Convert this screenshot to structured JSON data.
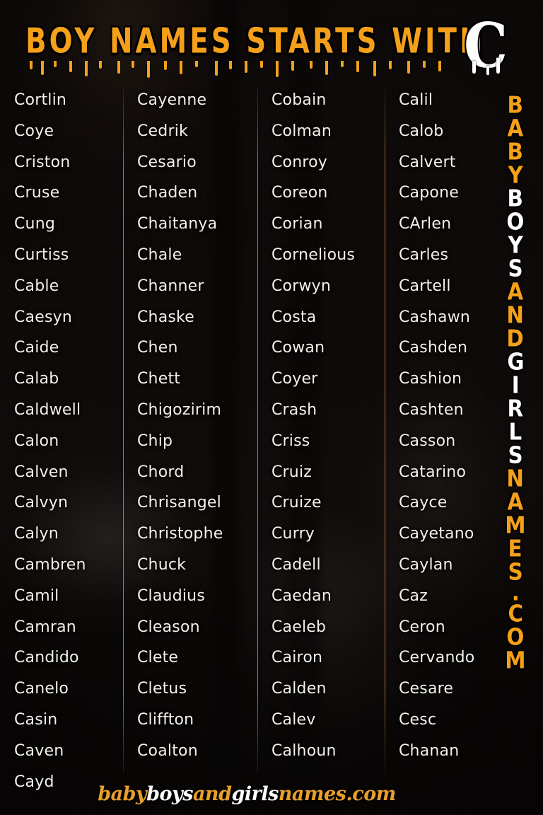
{
  "header": {
    "title": "BOY NAMES STARTS WITH",
    "letter_badge": "C",
    "accent_color": "#F5A01A",
    "badge_color": "#FFFFFF"
  },
  "columns": [
    {
      "id": "column-1",
      "names": [
        "Cortlin",
        "Coye",
        "Criston",
        "Cruse",
        "Cung",
        "Curtiss",
        "Cable",
        "Caesyn",
        "Caide",
        "Calab",
        "Caldwell",
        "Calon",
        "Calven",
        "Calvyn",
        "Calyn",
        "Cambren",
        "Camil",
        "Camran",
        "Candido",
        "Canelo",
        "Casin",
        "Caven",
        "Cayd"
      ]
    },
    {
      "id": "column-2",
      "names": [
        "Cayenne",
        "Cedrik",
        "Cesario",
        "Chaden",
        "Chaitanya",
        "Chale",
        "Channer",
        "Chaske",
        "Chen",
        "Chett",
        "Chigozirim",
        "Chip",
        "Chord",
        "Chrisangel",
        "Christophe",
        "Chuck",
        "Claudius",
        "Cleason",
        "Clete",
        "Cletus",
        "Cliffton",
        "Coalton"
      ]
    },
    {
      "id": "column-3",
      "names": [
        "Cobain",
        "Colman",
        "Conroy",
        "Coreon",
        "Corian",
        "Cornelious",
        "Corwyn",
        "Costa",
        "Cowan",
        "Coyer",
        "Crash",
        "Criss",
        "Cruiz",
        "Cruize",
        "Curry",
        "Cadell",
        "Caedan",
        "Caeleb",
        "Cairon",
        "Calden",
        "Calev",
        "Calhoun"
      ]
    },
    {
      "id": "column-4",
      "names": [
        "Calil",
        "Calob",
        "Calvert",
        "Capone",
        "CArlen",
        "Carles",
        "Cartell",
        "Cashawn",
        "Cashden",
        "Cashion",
        "Cashten",
        "Casson",
        "Catarino",
        "Cayce",
        "Cayetano",
        "Caylan",
        "Caz",
        "Ceron",
        "Cervando",
        "Cesare",
        "Cesc",
        "Chanan"
      ]
    }
  ],
  "vertical_brand": {
    "full_text": "BABYBOYSANDGIRLSNAMES.COM",
    "segments": [
      {
        "text": "BABY",
        "color": "#F5A01A"
      },
      {
        "text": "BOYS",
        "color": "#FFFFFF"
      },
      {
        "text": "AND",
        "color": "#F5A01A"
      },
      {
        "text": "GIRLS",
        "color": "#FFFFFF"
      },
      {
        "text": "NAMES",
        "color": "#F5A01A"
      },
      {
        "text": ".COM",
        "color": "#F5A01A"
      }
    ]
  },
  "footer_watermark": {
    "full_text": "babyboysandgirlsnames.com",
    "segments": [
      {
        "text": "baby",
        "color": "#E8A02B"
      },
      {
        "text": "boys",
        "color": "#FFFFFF"
      },
      {
        "text": "and",
        "color": "#E8A02B"
      },
      {
        "text": "girls",
        "color": "#FFFFFF"
      },
      {
        "text": "names.com",
        "color": "#E8A02B"
      }
    ]
  }
}
